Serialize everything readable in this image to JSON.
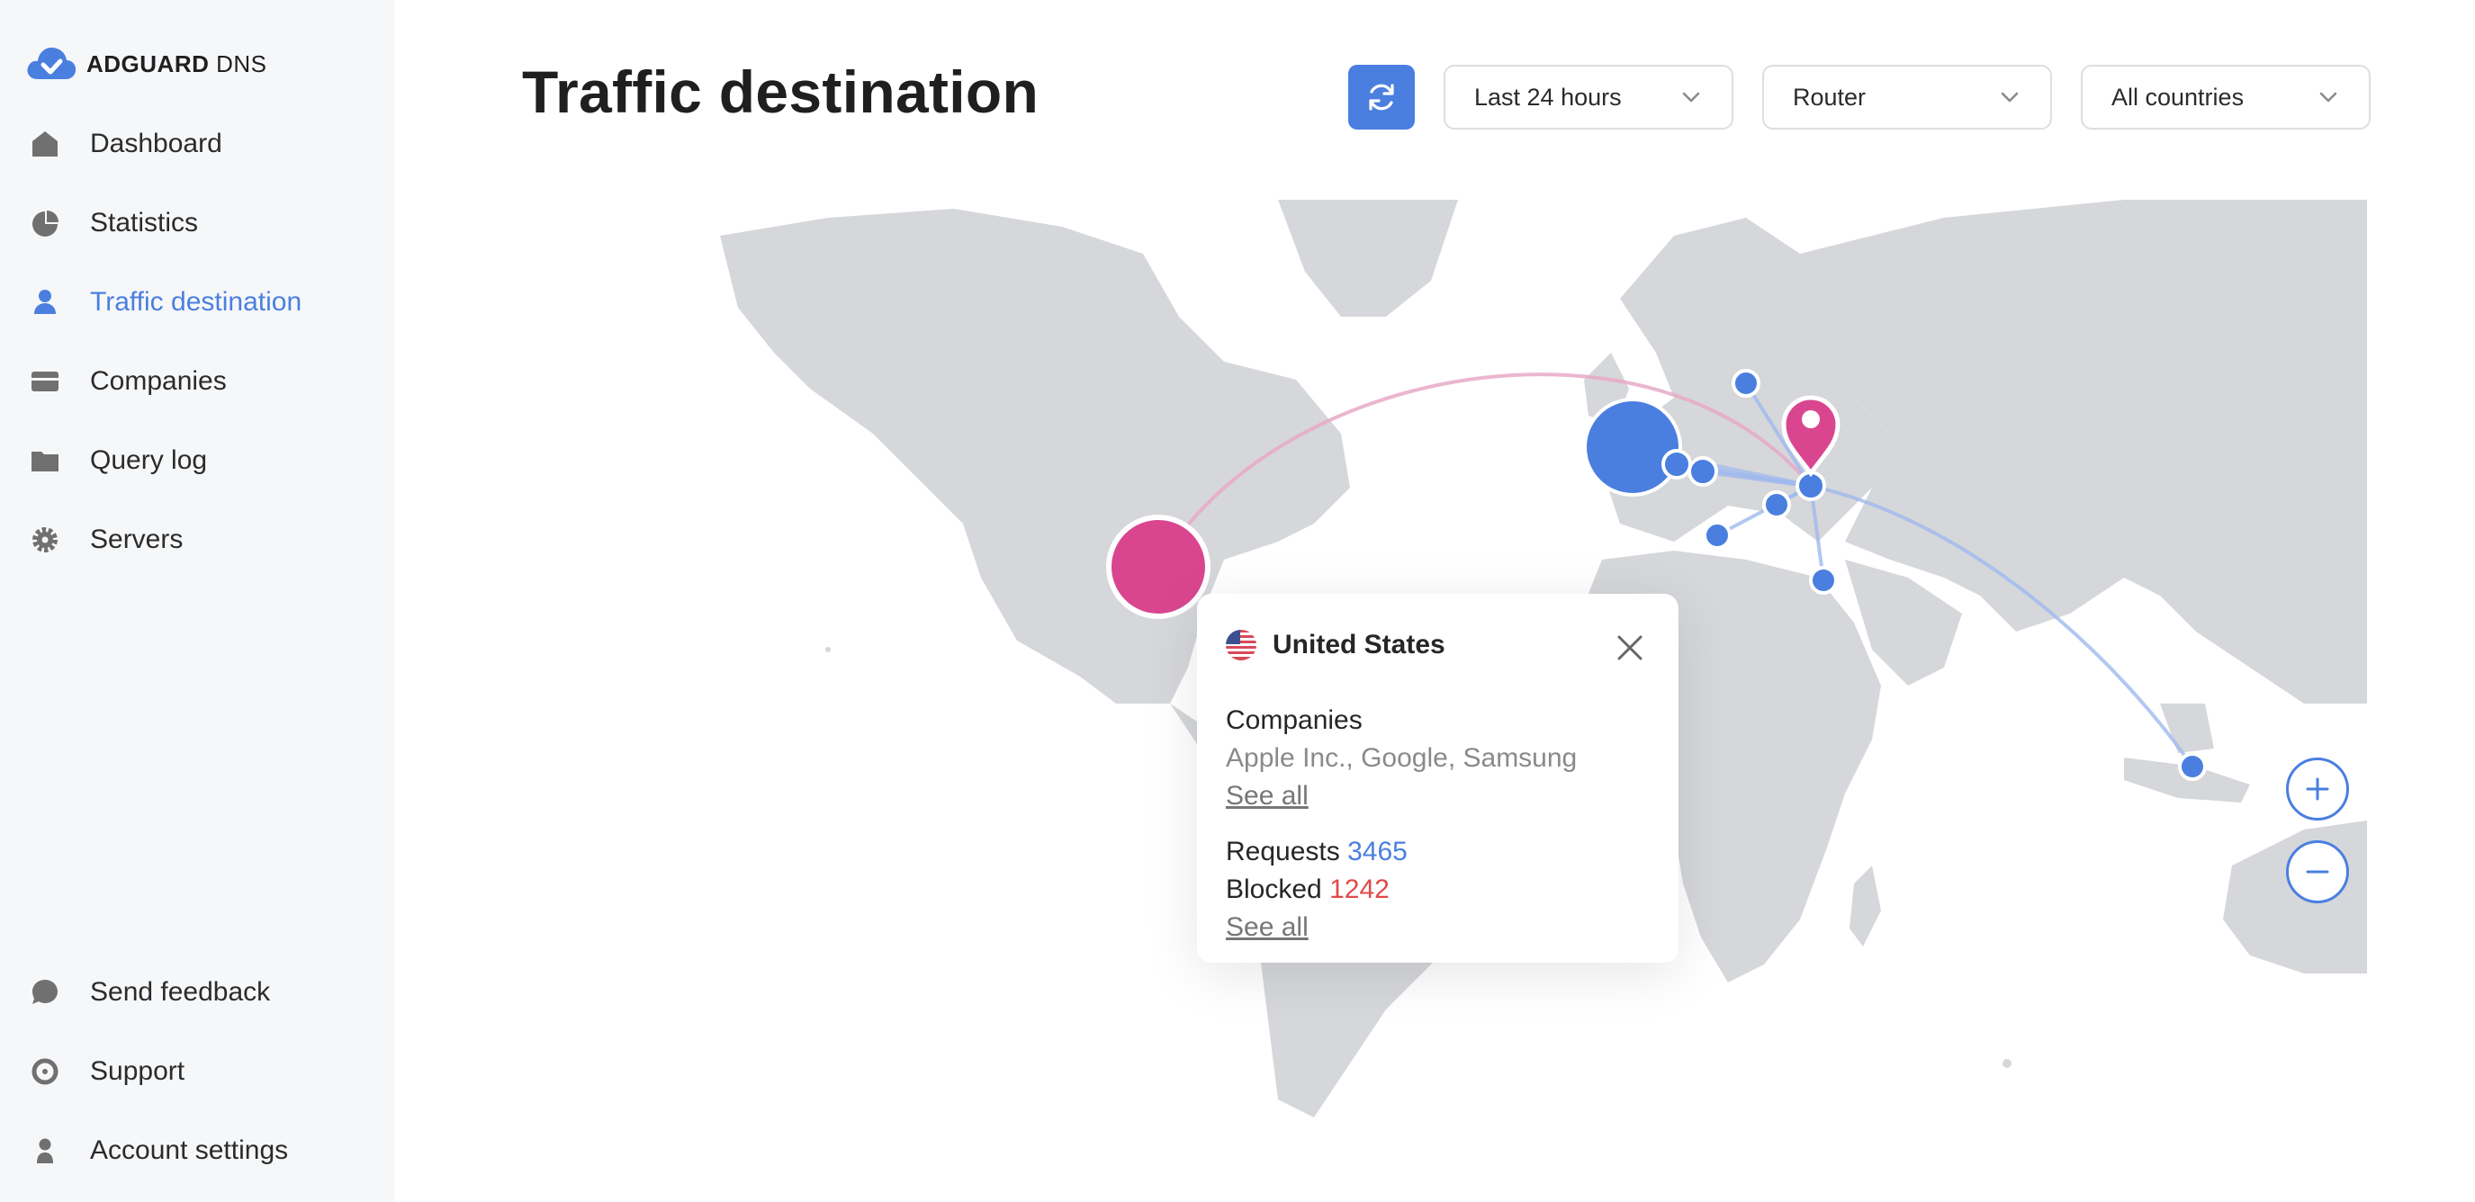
{
  "brand": {
    "name_bold": "ADGUARD",
    "name_light": " DNS"
  },
  "sidebar": {
    "items": [
      {
        "label": "Dashboard",
        "icon": "home-icon"
      },
      {
        "label": "Statistics",
        "icon": "pie-chart-icon"
      },
      {
        "label": "Traffic destination",
        "icon": "location-user-icon",
        "active": true
      },
      {
        "label": "Companies",
        "icon": "card-icon"
      },
      {
        "label": "Query log",
        "icon": "folder-icon"
      },
      {
        "label": "Servers",
        "icon": "gear-icon"
      }
    ],
    "bottom_items": [
      {
        "label": "Send feedback",
        "icon": "chat-bubble-icon"
      },
      {
        "label": "Support",
        "icon": "lifebuoy-icon"
      },
      {
        "label": "Account settings",
        "icon": "user-icon"
      }
    ]
  },
  "header": {
    "title": "Traffic destination",
    "filters": {
      "period": "Last 24 hours",
      "device": "Router",
      "country": "All countries"
    }
  },
  "popup": {
    "country": "United States",
    "companies_label": "Companies",
    "companies_value": "Apple Inc., Google, Samsung",
    "see_all_1": "See all",
    "requests_label": "Requests",
    "requests_value": "3465",
    "blocked_label": "Blocked",
    "blocked_value": "1242",
    "see_all_2": "See all"
  },
  "colors": {
    "accent": "#4a7fe0",
    "highlight": "#d9468f",
    "blocked": "#e04a4a",
    "land": "#d6d7da",
    "sidebar_bg": "#f6f7f9"
  }
}
